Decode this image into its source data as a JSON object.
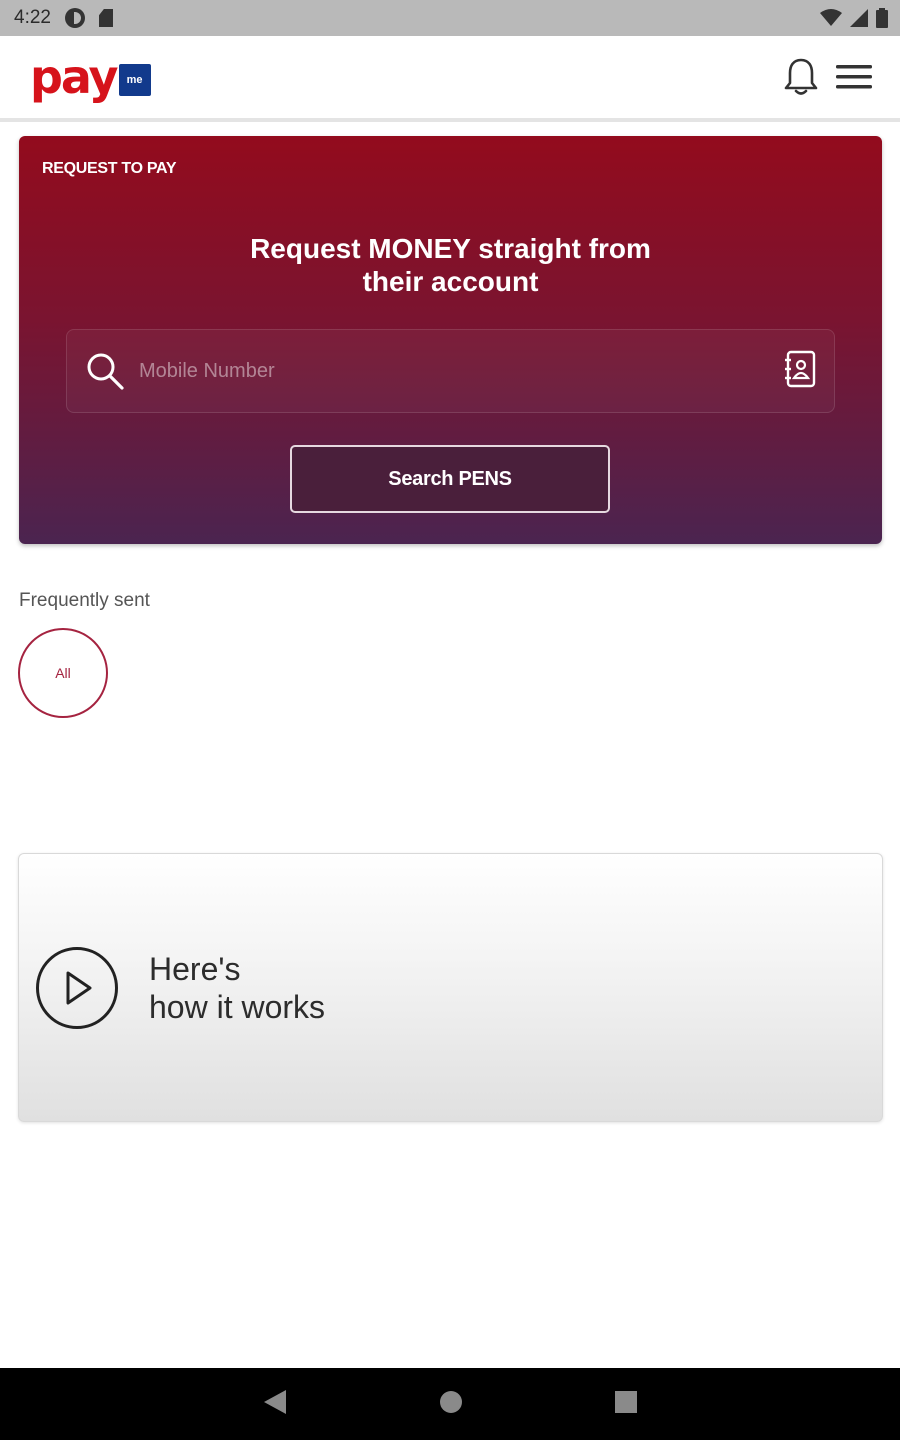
{
  "status_bar": {
    "time": "4:22",
    "icons": [
      "data-saver-icon",
      "sd-card-icon",
      "wifi-icon",
      "signal-icon",
      "battery-icon"
    ]
  },
  "header": {
    "logo_text": "pay",
    "logo_badge": "me",
    "brand_red": "#d6131b",
    "brand_blue": "#123a8c",
    "icons": [
      "bell-icon",
      "menu-icon"
    ]
  },
  "hero": {
    "kicker": "REQUEST TO PAY",
    "title_line1": "Request MONEY straight from",
    "title_line2": "their account",
    "search_placeholder": "Mobile Number",
    "search_value": "",
    "search_button_label": "Search PENS",
    "gradient_top": "#930b1d",
    "gradient_bottom": "#4b2450"
  },
  "frequently_sent": {
    "label": "Frequently sent",
    "chips": [
      {
        "label": "All"
      }
    ]
  },
  "how_it_works": {
    "line1": "Here's",
    "line2": "how it works",
    "icon": "play-icon"
  },
  "nav_bar": {
    "icons": [
      "back-icon",
      "home-icon",
      "recents-icon"
    ]
  }
}
